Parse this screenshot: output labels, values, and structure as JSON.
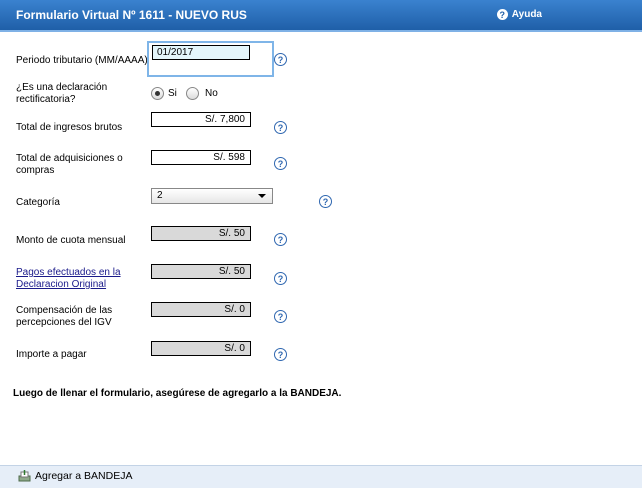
{
  "header": {
    "title": "Formulario Virtual Nº 1611 - NUEVO RUS",
    "help_label": "Ayuda"
  },
  "form": {
    "periodo": {
      "label": "Periodo tributario (MM/AAAA)",
      "value": "01/2017"
    },
    "rectificatoria": {
      "label_1": "¿Es una declaración",
      "label_2": "rectificatoria?",
      "option_si": "Si",
      "option_no": "No",
      "selected": "Si"
    },
    "ingresos": {
      "label": "Total de ingresos brutos",
      "value": "S/. 7,800"
    },
    "adquisiciones": {
      "label_1": "Total de adquisiciones o",
      "label_2": "compras",
      "value": "S/. 598"
    },
    "categoria": {
      "label": "Categoría",
      "value": "2"
    },
    "cuota": {
      "label": "Monto de cuota mensual",
      "value": "S/. 50"
    },
    "pagos": {
      "label_1": "Pagos efectuados en la",
      "label_2": "Declaracion Original",
      "value": "S/. 50"
    },
    "compensacion": {
      "label_1": "Compensación de las",
      "label_2": "percepciones del IGV",
      "value": "S/. 0"
    },
    "importe": {
      "label": "Importe a pagar",
      "value": "S/. 0"
    }
  },
  "note": "Luego de llenar el formulario, asegúrese de agregarlo a la BANDEJA.",
  "footer": {
    "add_label": "Agregar a BANDEJA"
  },
  "icons": {
    "help": "question-circle-icon",
    "tray": "tray-icon"
  }
}
